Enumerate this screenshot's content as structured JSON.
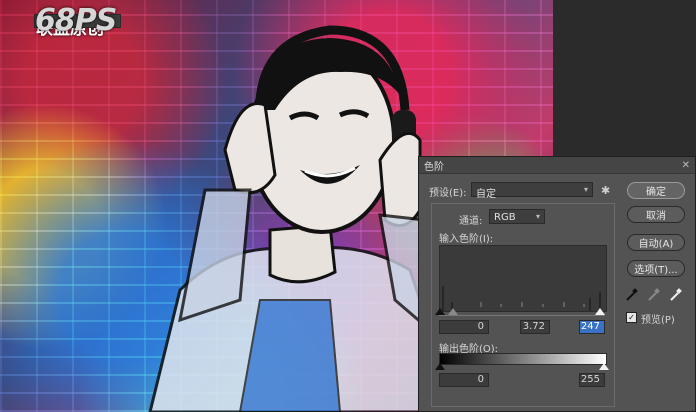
{
  "watermark": {
    "number": "68PS",
    "text": "联盟原创"
  },
  "dialog": {
    "title": "色阶",
    "close_icon": "close-icon",
    "preset_label": "预设(E):",
    "preset_value": "自定",
    "channel_label": "通道:",
    "channel_value": "RGB",
    "input_levels_label": "输入色阶(I):",
    "input_levels": {
      "black": "0",
      "gamma": "3.72",
      "white": "247"
    },
    "output_levels_label": "输出色阶(O):",
    "output_levels": {
      "black": "0",
      "white": "255"
    },
    "buttons": {
      "ok": "确定",
      "cancel": "取消",
      "auto": "自动(A)",
      "options": "选项(T)..."
    },
    "preview_label": "预览(P)",
    "preview_checked": true,
    "eyedroppers": [
      "black-eyedropper-icon",
      "gray-eyedropper-icon",
      "white-eyedropper-icon"
    ]
  }
}
